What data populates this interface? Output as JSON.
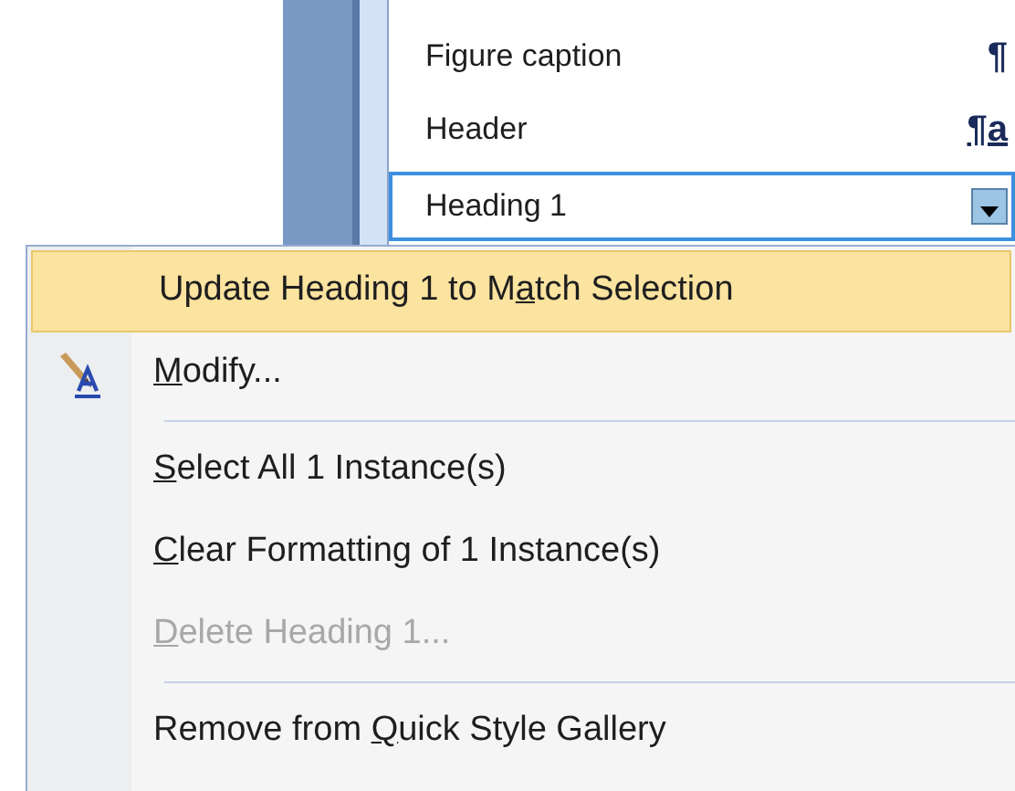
{
  "styles_pane": {
    "items": [
      {
        "name": "Figure caption",
        "mark": "¶",
        "kind": "paragraph",
        "selected": false
      },
      {
        "name": "Header",
        "mark": "¶a",
        "kind": "linked",
        "selected": false
      },
      {
        "name": "Heading 1",
        "kind": "dropdown",
        "selected": true
      }
    ]
  },
  "context_menu": {
    "items": [
      {
        "kind": "plain",
        "pre": "Update Heading 1 to M",
        "key": "a",
        "post": "tch Selection",
        "highlighted": true,
        "disabled": false,
        "separator_before": false
      },
      {
        "kind": "with_icon",
        "key": "M",
        "post": "odify...",
        "highlighted": false,
        "disabled": false,
        "separator_before": false
      },
      {
        "kind": "plain",
        "key": "S",
        "post": "elect All 1 Instance(s)",
        "highlighted": false,
        "disabled": false,
        "separator_before": true
      },
      {
        "kind": "plain",
        "key": "C",
        "post": "lear Formatting of 1 Instance(s)",
        "highlighted": false,
        "disabled": false,
        "separator_before": false
      },
      {
        "kind": "plain",
        "key": "D",
        "post": "elete Heading 1...",
        "highlighted": false,
        "disabled": true,
        "separator_before": false
      },
      {
        "kind": "plain",
        "pre": "Remove from ",
        "key": "Q",
        "post": "uick Style Gallery",
        "highlighted": false,
        "disabled": false,
        "separator_before": true
      }
    ]
  }
}
